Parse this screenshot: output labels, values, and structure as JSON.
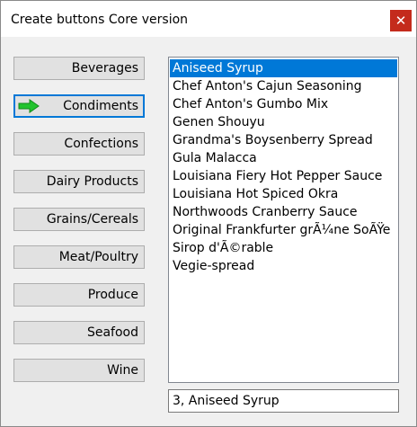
{
  "window": {
    "title": "Create buttons Core version",
    "close_label": "✕"
  },
  "categories": [
    {
      "label": "Beverages"
    },
    {
      "label": "Condiments",
      "selected": true
    },
    {
      "label": "Confections"
    },
    {
      "label": "Dairy Products"
    },
    {
      "label": "Grains/Cereals"
    },
    {
      "label": "Meat/Poultry"
    },
    {
      "label": "Produce"
    },
    {
      "label": "Seafood"
    },
    {
      "label": "Wine"
    }
  ],
  "products": [
    "Aniseed Syrup",
    "Chef Anton's Cajun Seasoning",
    "Chef Anton's Gumbo Mix",
    "Genen Shouyu",
    "Grandma's Boysenberry Spread",
    "Gula Malacca",
    "Louisiana Fiery Hot Pepper Sauce",
    "Louisiana Hot Spiced Okra",
    "Northwoods Cranberry Sauce",
    "Original Frankfurter grÃ¼ne SoÃŸe",
    "Sirop d'Ã©rable",
    "Vegie-spread"
  ],
  "selected_product_index": 0,
  "status_text": "3, Aniseed Syrup",
  "colors": {
    "accent": "#0078d7",
    "close_red": "#c42b1c",
    "arrow_green": "#22c32e"
  },
  "icons": {
    "selected_indicator": "green-right-arrow-icon",
    "close": "close-icon"
  }
}
